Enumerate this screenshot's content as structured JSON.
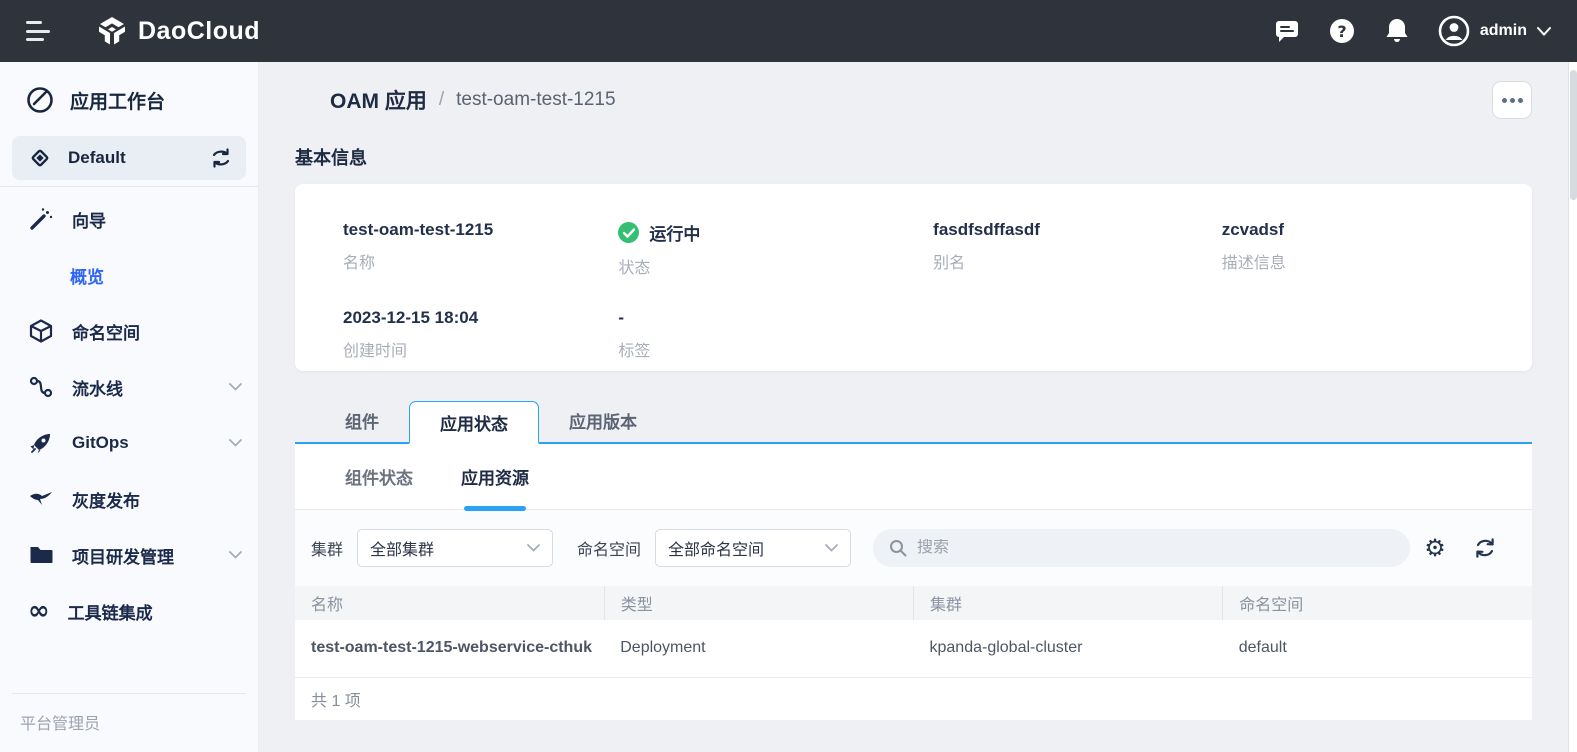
{
  "topbar": {
    "brand": "DaoCloud",
    "user": "admin"
  },
  "sidebar": {
    "workspace_label": "应用工作台",
    "selected_label": "Default",
    "items": [
      {
        "label": "向导"
      },
      {
        "label": "概览"
      },
      {
        "label": "命名空间"
      },
      {
        "label": "流水线"
      },
      {
        "label": "GitOps"
      },
      {
        "label": "灰度发布"
      },
      {
        "label": "项目研发管理"
      },
      {
        "label": "工具链集成"
      }
    ],
    "footer_label": "平台管理员"
  },
  "breadcrumb": {
    "root": "OAM 应用",
    "separator": "/",
    "current": "test-oam-test-1215"
  },
  "section_title": "基本信息",
  "info_card": {
    "fields": [
      {
        "value": "test-oam-test-1215",
        "label": "名称"
      },
      {
        "value": "运行中",
        "label": "状态"
      },
      {
        "value": "fasdfsdffasdf",
        "label": "别名"
      },
      {
        "value": "zcvadsf",
        "label": "描述信息"
      },
      {
        "value": "2023-12-15 18:04",
        "label": "创建时间"
      },
      {
        "value": "-",
        "label": "标签"
      }
    ]
  },
  "tabs": [
    {
      "label": "组件"
    },
    {
      "label": "应用状态"
    },
    {
      "label": "应用版本"
    }
  ],
  "subtabs": [
    {
      "label": "组件状态"
    },
    {
      "label": "应用资源"
    }
  ],
  "filters": {
    "cluster_label": "集群",
    "cluster_value": "全部集群",
    "namespace_label": "命名空间",
    "namespace_value": "全部命名空间",
    "search_placeholder": "搜索"
  },
  "table": {
    "columns": [
      "名称",
      "类型",
      "集群",
      "命名空间"
    ],
    "rows": [
      [
        "test-oam-test-1215-webservice-cthuk",
        "Deployment",
        "kpanda-global-cluster",
        "default"
      ]
    ],
    "footer": "共 1 项"
  },
  "colors": {
    "topbar_bg": "#2f343c",
    "accent_blue": "#3066f5",
    "tab_blue": "#2aa2f4",
    "success_green": "#34bf72",
    "sidebar_bg": "#f9fafd",
    "page_bg": "#eef0f4"
  }
}
